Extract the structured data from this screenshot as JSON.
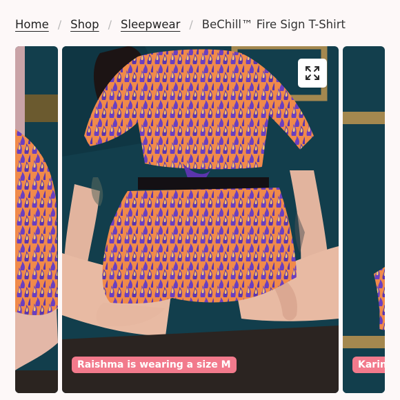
{
  "breadcrumb": {
    "items": [
      {
        "label": "Home"
      },
      {
        "label": "Shop"
      },
      {
        "label": "Sleepwear"
      }
    ],
    "current": "BeChill™ Fire Sign T-Shirt",
    "separator": "/"
  },
  "gallery": {
    "main": {
      "caption": "Raishma is wearing a size M",
      "expand_icon": "expand-arrows-icon"
    },
    "next": {
      "caption": "Karina is wearing a size M"
    }
  },
  "colors": {
    "background": "#fdf8f8",
    "caption_bg": "#f27a8c",
    "wall": "#123e4c",
    "print_orange": "#f08a4a",
    "print_purple": "#6a3fc0"
  }
}
